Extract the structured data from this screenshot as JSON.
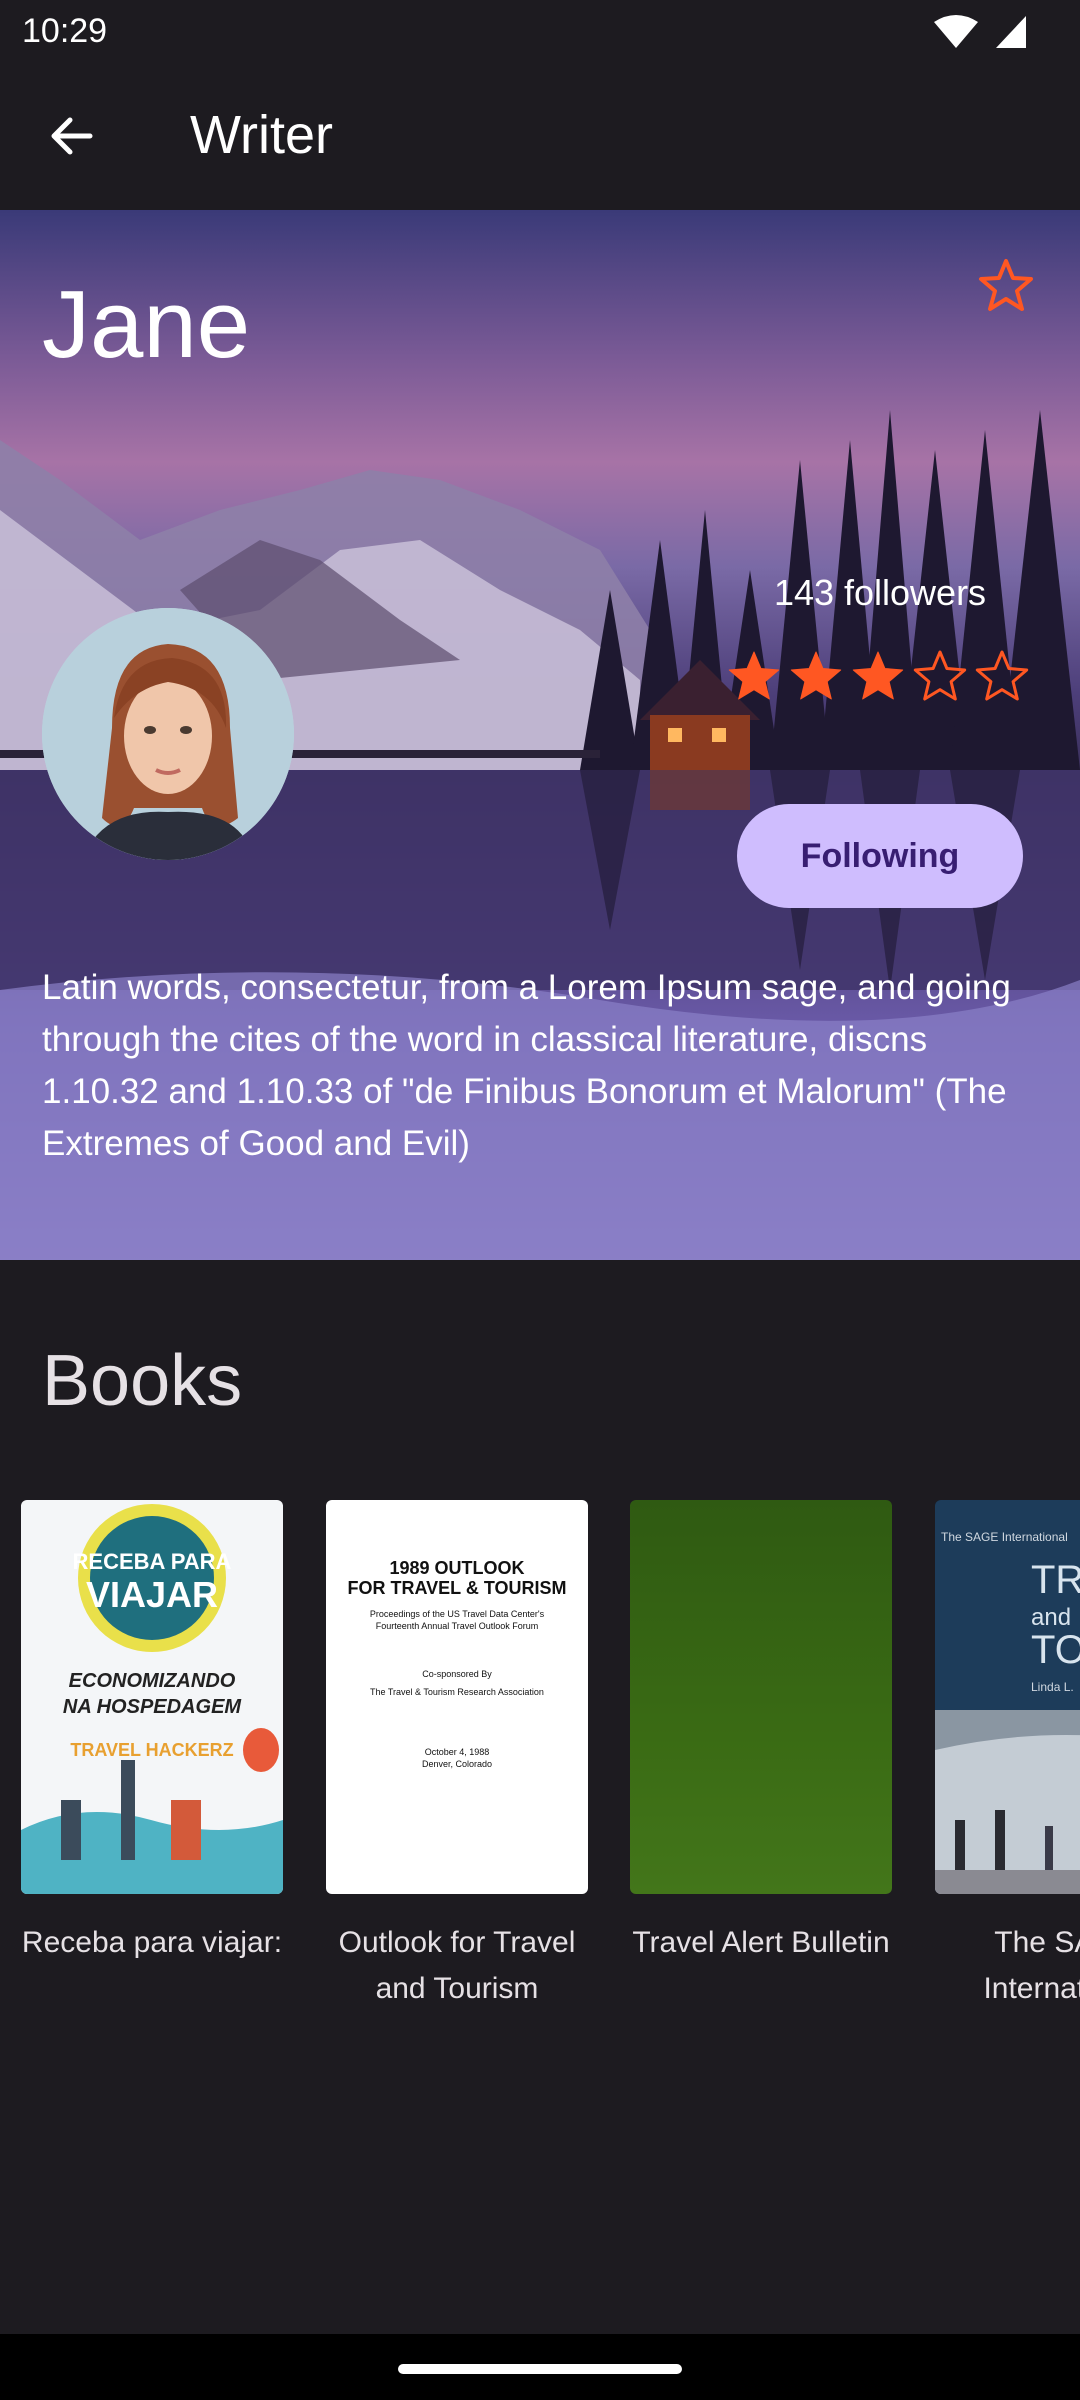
{
  "status_bar": {
    "time": "10:29"
  },
  "app_bar": {
    "title": "Writer"
  },
  "writer": {
    "name": "Jane",
    "followers": "143 followers",
    "rating": 3,
    "rating_max": 5,
    "follow_button_label": "Following",
    "bio": "Latin words, consectetur, from a Lorem Ipsum sage, and going through the cites of the word in classical literature, discns 1.10.32 and 1.10.33 of \"de Finibus Bonorum et Malorum\" (The Extremes of Good and Evil)"
  },
  "books_section": {
    "title": "Books",
    "books": [
      {
        "title": "Receba para viajar:",
        "cover_text": [
          "RECEBA PARA",
          "VIAJAR",
          "ECONOMIZANDO",
          "NA HOSPEDAGEM",
          "TRAVEL HACKERZ"
        ]
      },
      {
        "title": "Outlook for Travel and Tourism",
        "cover_text": [
          "1989 OUTLOOK",
          "FOR TRAVEL & TOURISM",
          "Proceedings of the US Travel Data Center's",
          "Fourteenth Annual Travel Outlook Forum",
          "Co-sponsored By",
          "The Travel & Tourism Research Association",
          "October 4, 1988",
          "Denver, Colorado"
        ]
      },
      {
        "title": "Travel Alert Bulletin",
        "cover_text": []
      },
      {
        "title": "The SAGE International",
        "cover_text": [
          "The SAGE International",
          "TRAV",
          "and",
          "TOUR",
          "Linda L."
        ]
      }
    ]
  },
  "colors": {
    "background": "#1d1b20",
    "accent_star": "#ff5722",
    "follow_button_bg": "#cfbdfe",
    "follow_button_text": "#381e72"
  }
}
